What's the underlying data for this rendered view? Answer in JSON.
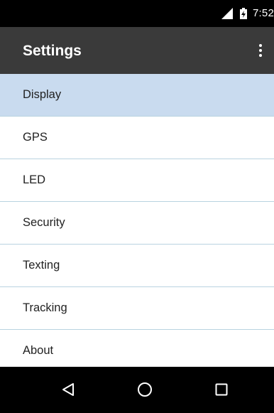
{
  "status_bar": {
    "time": "7:52",
    "icons": [
      "signal-icon",
      "battery-charging-icon"
    ]
  },
  "toolbar": {
    "title": "Settings",
    "overflow_icon": "more-vert-icon"
  },
  "menu": {
    "items": [
      {
        "label": "Display",
        "selected": true
      },
      {
        "label": "GPS",
        "selected": false
      },
      {
        "label": "LED",
        "selected": false
      },
      {
        "label": "Security",
        "selected": false
      },
      {
        "label": "Texting",
        "selected": false
      },
      {
        "label": "Tracking",
        "selected": false
      },
      {
        "label": "About",
        "selected": false
      }
    ]
  },
  "nav_bar": {
    "buttons": [
      "back-icon",
      "home-icon",
      "recents-icon"
    ]
  },
  "colors": {
    "toolbar": "#3a3a3a",
    "selected_row": "#c9dbef",
    "divider": "#b9d3e0"
  }
}
